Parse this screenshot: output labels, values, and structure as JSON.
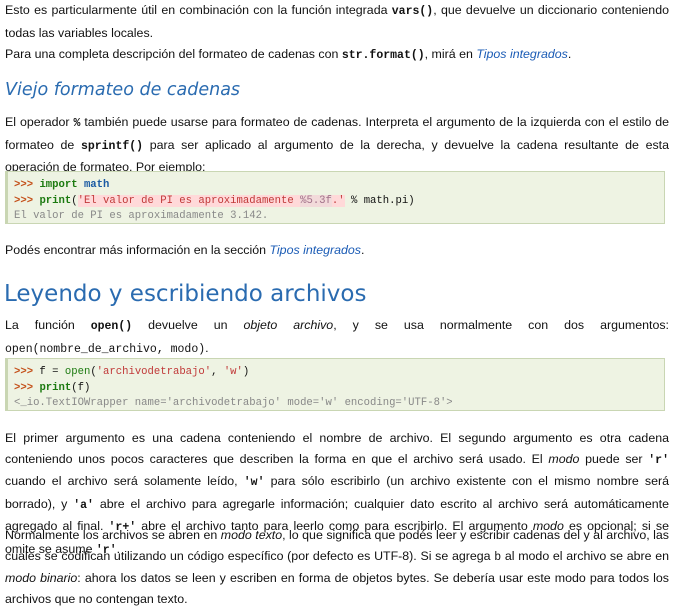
{
  "p1": {
    "a": "Esto es particularmente útil en combinación con la función integrada ",
    "code": "vars()",
    "b": ", que devuelve un diccionario conteniendo todas las variables locales."
  },
  "p2": {
    "a": "Para una completa descripción del formateo de cadenas con ",
    "code": "str.format()",
    "b": ", mirá en ",
    "link": "Tipos integrados",
    "c": "."
  },
  "h_old": "Viejo formateo de cadenas",
  "p3": {
    "a": "El operador ",
    "code1": "%",
    "b": " también puede usarse para formateo de cadenas. Interpreta el argumento de la izquierda con el estilo de formateo de ",
    "code2": "sprintf()",
    "c": " para ser aplicado al argumento de la derecha, y devuelve la cadena resultante de esta operación de formateo. Por ejemplo:"
  },
  "code1": {
    "l1_prompt": ">>>",
    "l1_kw": "import",
    "l1_mod": "math",
    "l2_prompt": ">>>",
    "l2_fn": "print",
    "l2_open": "(",
    "l2_str_a": "'El valor de PI es aproximadamente ",
    "l2_fmt": "%5.3f",
    "l2_str_b": ".'",
    "l2_rest": " % math.pi)",
    "l3": "El valor de PI es aproximadamente 3.142."
  },
  "p4": {
    "a": "Podés encontrar más información en la sección ",
    "link": "Tipos integrados",
    "b": "."
  },
  "h_files": "Leyendo y escribiendo archivos",
  "p5": {
    "a": "La función ",
    "code": "open()",
    "b": " devuelve un ",
    "em": "objeto archivo",
    "c": ", y se usa normalmente con dos argumentos:",
    "code2": "open(nombre_de_archivo, modo)",
    "d": "."
  },
  "code2": {
    "l1_prompt": ">>>",
    "l1_a": " f = ",
    "l1_fn": "open",
    "l1_b": "(",
    "l1_s1": "'archivodetrabajo'",
    "l1_c": ", ",
    "l1_s2": "'w'",
    "l1_d": ")",
    "l2_prompt": ">>>",
    "l2_fn": "print",
    "l2_a": "(f)",
    "l3": "<_io.TextIOWrapper name='archivodetrabajo' mode='w' encoding='UTF-8'>"
  },
  "p6": {
    "a": "El primer argumento es una cadena conteniendo el nombre de archivo. El segundo argumento es otra cadena conteniendo unos pocos caracteres que describen la forma en que el archivo será usado. El ",
    "em1": "modo",
    "b": " puede ser ",
    "c1": "'r'",
    "c": " cuando el archivo será solamente leído, ",
    "c2": "'w'",
    "d": " para sólo escribirlo (un archivo existente con el mismo nombre será borrado), y ",
    "c3": "'a'",
    "e": " abre el archivo para agregarle información; cualquier dato escrito al archivo será automáticamente agregado al final. ",
    "c4": "'r+'",
    "f": " abre el archivo tanto para leerlo como para escribirlo. El argumento ",
    "em2": "modo",
    "g": " es opcional; si se omite se asume ",
    "c5": "'r'",
    "h": "."
  },
  "p7": {
    "a": "Normalmente los archivos se abren en ",
    "em1": "modo texto",
    "b": ", lo que significa que podés leer y escribir cadenas del y al archivo, las cuales se codifican utilizando un código específico (por defecto es UTF-8). Si se agrega ",
    "code": "b",
    "c": " al modo el archivo se abre en ",
    "em2": "modo binario",
    "d": ": ahora los datos se leen y escriben en forma de objetos bytes. Se debería usar este modo para todos los archivos que no contengan texto."
  }
}
